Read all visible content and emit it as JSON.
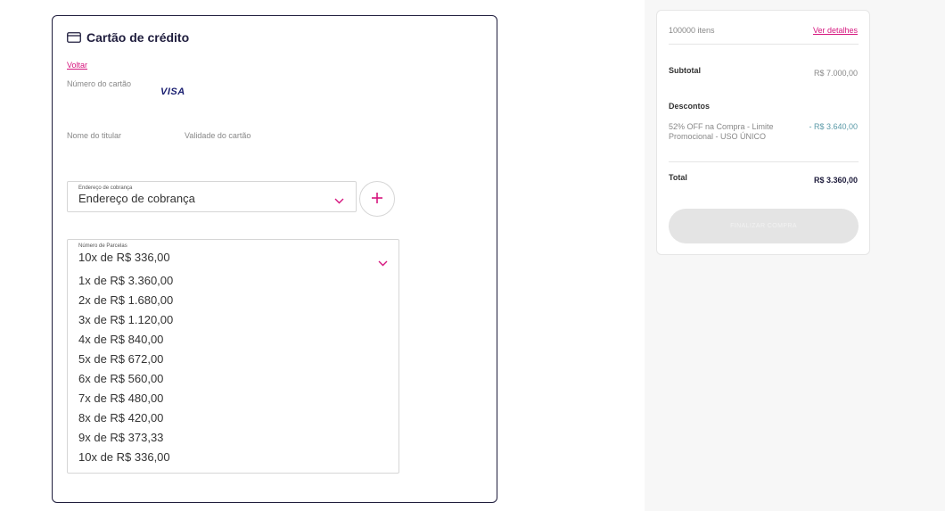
{
  "payment": {
    "title": "Cartão de crédito",
    "back_label": "Voltar",
    "card_number_label": "Número do cartão",
    "card_brand": "VISA",
    "holder_name_label": "Nome do titular",
    "expiry_label": "Validade do cartão",
    "billing_address": {
      "float_label": "Endereço de cobrança",
      "value": "Endereço de cobrança"
    },
    "add_address_symbol": "+",
    "installments": {
      "float_label": "Número de Parcelas",
      "selected": "10x de R$ 336,00",
      "options": [
        "1x de R$ 3.360,00",
        "2x de R$ 1.680,00",
        "3x de R$ 1.120,00",
        "4x de R$ 840,00",
        "5x de R$ 672,00",
        "6x de R$ 560,00",
        "7x de R$ 480,00",
        "8x de R$ 420,00",
        "9x de R$ 373,33",
        "10x de R$ 336,00"
      ]
    }
  },
  "summary": {
    "items_count": "100000 itens",
    "details_link": "Ver detalhes",
    "subtotal_label": "Subtotal",
    "subtotal_value": "R$ 7.000,00",
    "discounts_label": "Descontos",
    "discount_desc": "52% OFF na Compra - Limite Promocional - USO ÚNICO",
    "discount_value": "- R$ 3.640,00",
    "total_label": "Total",
    "total_value": "R$ 3.360,00",
    "finish_button": "FINALIZAR COMPRA"
  },
  "colors": {
    "accent": "#d6157e",
    "navy": "#1f1d3d",
    "discount": "#5b9aa8",
    "disabled_button": "#e4e4e4"
  }
}
